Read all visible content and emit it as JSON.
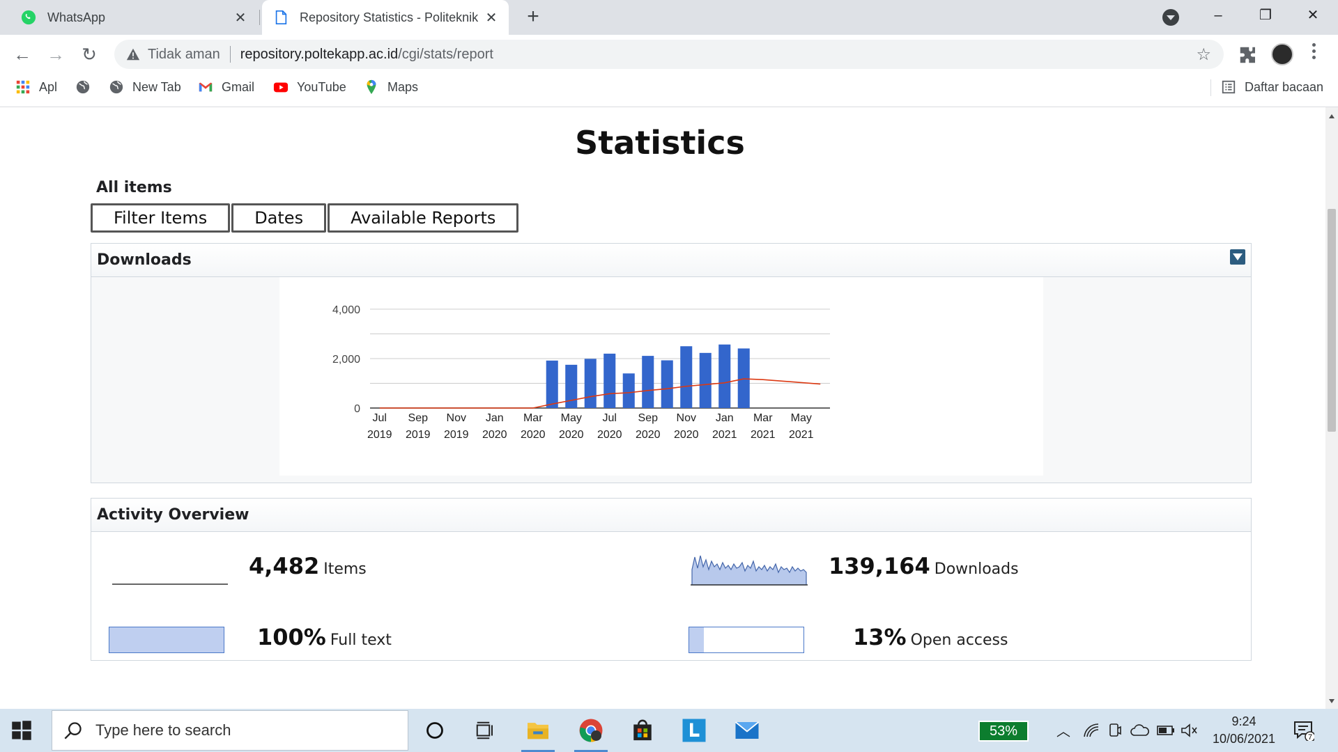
{
  "browser": {
    "tabs": [
      {
        "title": "WhatsApp",
        "active": false
      },
      {
        "title": "Repository Statistics - Politeknik Aceh",
        "active": true
      }
    ],
    "security_label": "Tidak aman",
    "url_host": "repository.poltekapp.ac.id",
    "url_path": "/cgi/stats/report",
    "bookmarks": [
      {
        "label": "Apl",
        "icon": "apps-grid-icon"
      },
      {
        "label": "",
        "icon": "globe-icon"
      },
      {
        "label": "New Tab",
        "icon": "globe-icon"
      },
      {
        "label": "Gmail",
        "icon": "gmail-icon"
      },
      {
        "label": "YouTube",
        "icon": "youtube-icon"
      },
      {
        "label": "Maps",
        "icon": "maps-pin-icon"
      }
    ],
    "reading_list": "Daftar bacaan"
  },
  "page": {
    "title": "Statistics",
    "scope": "All items",
    "buttons": {
      "filter": "Filter Items",
      "dates": "Dates",
      "reports": "Available Reports"
    }
  },
  "downloads_panel": {
    "title": "Downloads"
  },
  "chart_data": {
    "type": "bar",
    "title": "",
    "xlabel": "",
    "ylabel": "",
    "ylim": [
      0,
      4000
    ],
    "yticks": [
      0,
      2000,
      4000
    ],
    "ytick_labels": [
      "0",
      "2,000",
      "4,000"
    ],
    "xtick_labels": [
      [
        "Jul",
        "2019"
      ],
      [
        "Sep",
        "2019"
      ],
      [
        "Nov",
        "2019"
      ],
      [
        "Jan",
        "2020"
      ],
      [
        "Mar",
        "2020"
      ],
      [
        "May",
        "2020"
      ],
      [
        "Jul",
        "2020"
      ],
      [
        "Sep",
        "2020"
      ],
      [
        "Nov",
        "2020"
      ],
      [
        "Jan",
        "2021"
      ],
      [
        "Mar",
        "2021"
      ],
      [
        "May",
        "2021"
      ]
    ],
    "categories": [
      "Jul 2019",
      "Aug 2019",
      "Sep 2019",
      "Oct 2019",
      "Nov 2019",
      "Dec 2019",
      "Jan 2020",
      "Feb 2020",
      "Mar 2020",
      "Apr 2020",
      "May 2020",
      "Jun 2020",
      "Jul 2020",
      "Aug 2020",
      "Sep 2020",
      "Oct 2020",
      "Nov 2020",
      "Dec 2020",
      "Jan 2021",
      "Feb 2021",
      "Mar 2021",
      "Apr 2021",
      "May 2021",
      "Jun 2021"
    ],
    "series": [
      {
        "type": "bar",
        "color": "#3366cc",
        "values": [
          0,
          0,
          0,
          0,
          0,
          0,
          0,
          0,
          0,
          1920,
          1750,
          1990,
          2200,
          1400,
          2110,
          1930,
          2500,
          2230,
          2570,
          2410,
          0,
          0,
          0,
          0
        ]
      },
      {
        "type": "line",
        "color": "#dc3912",
        "values": [
          0,
          0,
          0,
          0,
          0,
          0,
          0,
          0,
          0,
          160,
          310,
          460,
          580,
          620,
          710,
          780,
          880,
          950,
          1020,
          1180,
          1150,
          1090,
          1030,
          970
        ]
      }
    ],
    "grid": true
  },
  "activity": {
    "title": "Activity Overview",
    "items_count": "4,482",
    "items_label": "Items",
    "downloads_count": "139,164",
    "downloads_label": "Downloads",
    "fulltext_pct": "100%",
    "fulltext_label": "Full text",
    "fulltext_value": 1.0,
    "openaccess_pct": "13%",
    "openaccess_label": "Open access",
    "openaccess_value": 0.13
  },
  "taskbar": {
    "search_placeholder": "Type here to search",
    "battery": "53%",
    "time": "9:24",
    "date": "10/06/2021",
    "notifications": "7"
  }
}
